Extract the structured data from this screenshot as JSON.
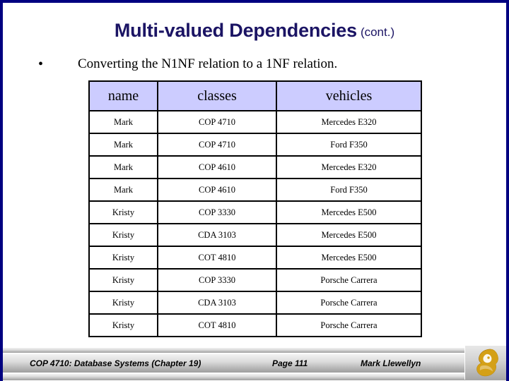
{
  "slide": {
    "title_main": "Multi-valued Dependencies",
    "title_sub": "(cont.)",
    "bullet_marker": "•",
    "bullet_text": "Converting the  N1NF relation to a 1NF relation.",
    "border_color": "#000080",
    "title_color": "#1b1464",
    "header_fill": "#ccccff"
  },
  "table": {
    "name": "relation-1nf",
    "columns": [
      "name",
      "classes",
      "vehicles"
    ],
    "rows": [
      [
        "Mark",
        "COP 4710",
        "Mercedes E320"
      ],
      [
        "Mark",
        "COP 4710",
        "Ford F350"
      ],
      [
        "Mark",
        "COP 4610",
        "Mercedes E320"
      ],
      [
        "Mark",
        "COP 4610",
        "Ford F350"
      ],
      [
        "Kristy",
        "COP 3330",
        "Mercedes E500"
      ],
      [
        "Kristy",
        "CDA 3103",
        "Mercedes E500"
      ],
      [
        "Kristy",
        "COT 4810",
        "Mercedes E500"
      ],
      [
        "Kristy",
        "COP 3330",
        "Porsche Carrera"
      ],
      [
        "Kristy",
        "CDA 3103",
        "Porsche Carrera"
      ],
      [
        "Kristy",
        "COT 4810",
        "Porsche Carrera"
      ]
    ]
  },
  "footer": {
    "course": "COP 4710: Database Systems  (Chapter 19)",
    "page": "Page 111",
    "author": "Mark Llewellyn",
    "logo": "ucf-pegasus-logo",
    "logo_color": "#d4a017"
  }
}
